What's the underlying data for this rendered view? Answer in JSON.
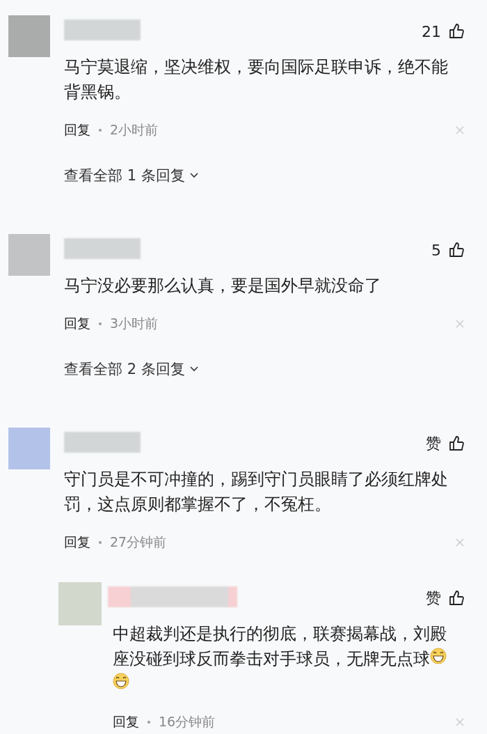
{
  "comments": [
    {
      "color": "#a9acab",
      "likes": "21",
      "parts": [
        {
          "kind": "text",
          "text": "马宁莫退缩，坚决维权，要向国际足联申诉，绝不能背黑锅。"
        }
      ],
      "reply_label": "回复",
      "time": "2小时前",
      "more_replies": "查看全部 1 条回复"
    },
    {
      "color": "#c2c3c5",
      "likes": "5",
      "parts": [
        {
          "kind": "text",
          "text": "马宁没必要那么认真，要是国外早就没命了"
        }
      ],
      "reply_label": "回复",
      "time": "3小时前",
      "more_replies": "查看全部 2 条回复"
    },
    {
      "color": "#b3c2e8",
      "likes": "赞",
      "parts": [
        {
          "kind": "text",
          "text": "守门员是不可冲撞的，踢到守门员眼睛了必须红牌处罚，这点原则都掌握不了，不冤枉。"
        }
      ],
      "reply_label": "回复",
      "time": "27分钟前",
      "children": [
        {
          "color": "#d3d8cc",
          "likes": "赞",
          "parts": [
            {
              "kind": "text",
              "text": "中超裁判还是执行的彻底，联赛揭幕战，刘殿座没碰到球反而拳击对手球员，无牌无点球"
            },
            {
              "kind": "emoji"
            },
            {
              "kind": "emoji"
            }
          ],
          "reply_label": "回复",
          "time": "16分钟前"
        }
      ]
    }
  ]
}
